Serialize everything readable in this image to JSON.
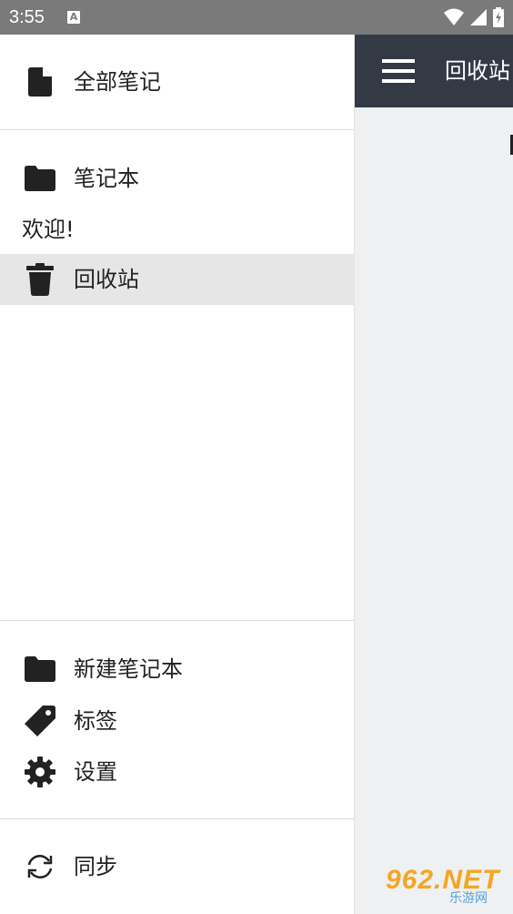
{
  "status_bar": {
    "time": "3:55",
    "notification_icon_letter": "A",
    "icons": [
      "wifi-icon",
      "signal-icon",
      "battery-charging-icon"
    ]
  },
  "app_bar": {
    "title": "回收站"
  },
  "drawer": {
    "all_notes": "全部笔记",
    "notebooks_header": "笔记本",
    "notebooks": [
      "欢迎!"
    ],
    "trash": "回收站",
    "new_notebook": "新建笔记本",
    "tags": "标签",
    "settings": "设置",
    "sync": "同步"
  },
  "watermark": {
    "logo": "962.NET",
    "subtitle": "乐游网"
  },
  "colors": {
    "status_bar": "#7a7a7a",
    "app_bar": "#333a45",
    "drawer_bg": "#ffffff",
    "selected_row": "#e6e6e6",
    "main_bg": "#eff0f2",
    "icon": "#222222"
  }
}
